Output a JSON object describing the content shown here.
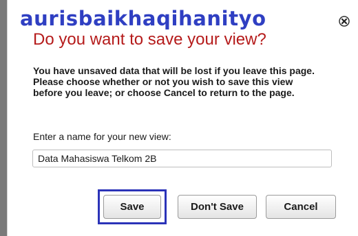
{
  "watermark": "aurisbaikhaqihanityo",
  "dialog": {
    "title": "Do you want to save your view?",
    "close_icon": "close-icon",
    "message": "You have unsaved data that will be lost if you leave this page. Please choose whether or not you wish to save this view before you leave; or choose Cancel to return to the page.",
    "name_label": "Enter a name for your new view:",
    "name_value": "Data Mahasiswa Telkom 2B",
    "buttons": {
      "save": "Save",
      "dont_save": "Don't Save",
      "cancel": "Cancel"
    }
  },
  "colors": {
    "title": "#b51b1b",
    "watermark": "#2f3fc2",
    "highlight": "#2b33b8"
  }
}
